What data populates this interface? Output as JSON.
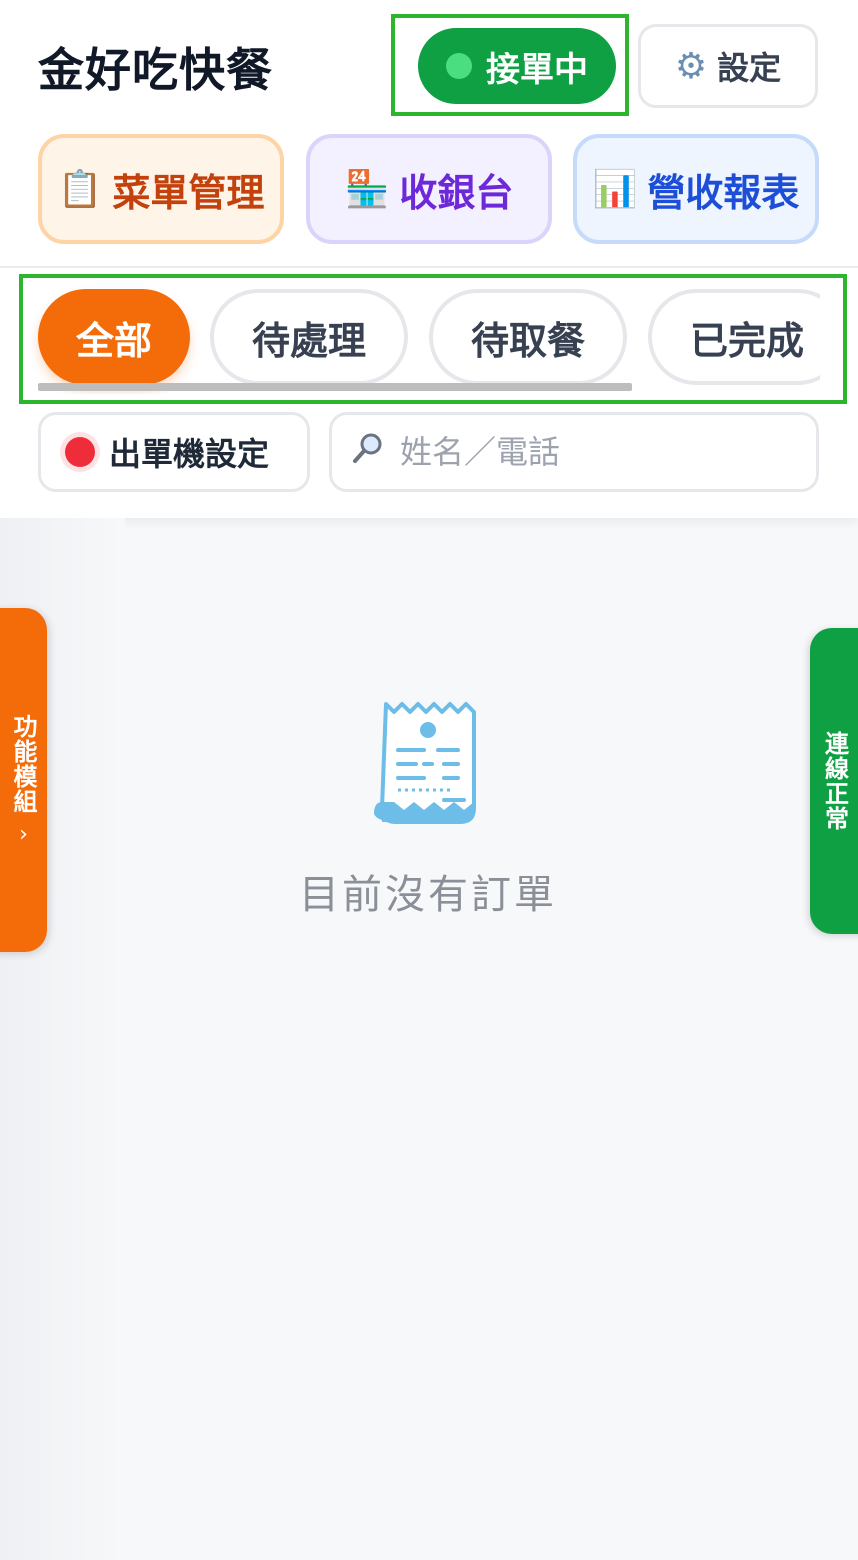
{
  "header": {
    "store_name": "金好吃快餐",
    "status_label": "接單中",
    "settings_label": "設定"
  },
  "modules": {
    "menu_label": "菜單管理",
    "menu_icon": "📋",
    "pos_label": "收銀台",
    "pos_icon": "🏪",
    "report_label": "營收報表",
    "report_icon": "📊"
  },
  "tabs": [
    {
      "label": "全部",
      "active": true
    },
    {
      "label": "待處理",
      "active": false
    },
    {
      "label": "待取餐",
      "active": false
    },
    {
      "label": "已完成",
      "active": false
    }
  ],
  "printer": {
    "label": "出單機設定",
    "status_color": "#ef2d3a"
  },
  "search": {
    "placeholder": "姓名／電話",
    "value": ""
  },
  "side_panel": {
    "left_label": "功能模組",
    "left_chevron": "›",
    "right_label": "連線正常"
  },
  "empty_state": {
    "message": "目前沒有訂單",
    "icon": "receipt-icon"
  },
  "colors": {
    "accent_orange": "#f46b0a",
    "accent_green": "#0ea043",
    "highlight_green": "#2db52d"
  }
}
